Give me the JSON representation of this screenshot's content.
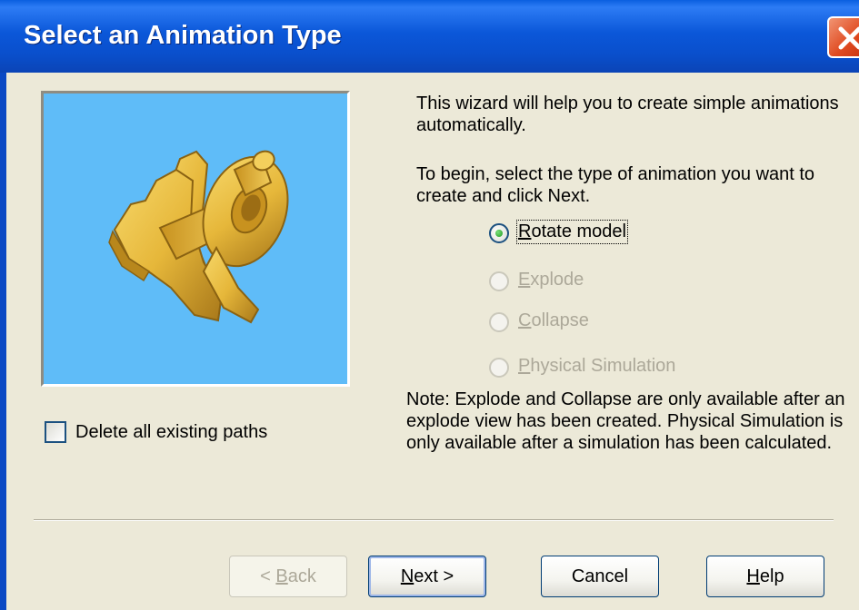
{
  "window": {
    "title": "Select an Animation Type"
  },
  "intro_text": "This wizard will help you to create simple animations automatically.",
  "instruction_text": "To begin, select the type of animation you want to create and click Next.",
  "animation_types": [
    {
      "label": "Rotate model",
      "mnemonic_prefix": "",
      "mnemonic": "R",
      "rest": "otate model",
      "selected": true,
      "enabled": true
    },
    {
      "label": "Explode",
      "mnemonic_prefix": "",
      "mnemonic": "E",
      "rest": "xplode",
      "selected": false,
      "enabled": false
    },
    {
      "label": "Collapse",
      "mnemonic_prefix": "",
      "mnemonic": "C",
      "rest": "ollapse",
      "selected": false,
      "enabled": false
    },
    {
      "label": "Physical Simulation",
      "mnemonic_prefix": "",
      "mnemonic": "P",
      "rest": "hysical Simulation",
      "selected": false,
      "enabled": false
    }
  ],
  "note_text": "Note: Explode and Collapse are only available after an explode view has been created. Physical Simulation is only available after a simulation has been calculated.",
  "delete_paths": {
    "label": "Delete all existing paths",
    "checked": false
  },
  "buttons": {
    "back": {
      "prefix": "< ",
      "mnemonic": "B",
      "rest": "ack",
      "enabled": false
    },
    "next": {
      "prefix": "",
      "mnemonic": "N",
      "rest": "ext >",
      "enabled": true
    },
    "cancel": {
      "label": "Cancel",
      "enabled": true
    },
    "help": {
      "prefix": "",
      "mnemonic": "H",
      "rest": "elp",
      "enabled": true
    }
  },
  "colors": {
    "title_bar": "#0a53d6",
    "close_button": "#e04a20",
    "preview_background": "#5fbcf8",
    "model_gold": "#e6b73a",
    "dialog_face": "#ece9d8",
    "disabled_text": "#aca899"
  },
  "icons": {
    "close": "close-x-icon",
    "preview": "gold-bracket-model-image"
  }
}
